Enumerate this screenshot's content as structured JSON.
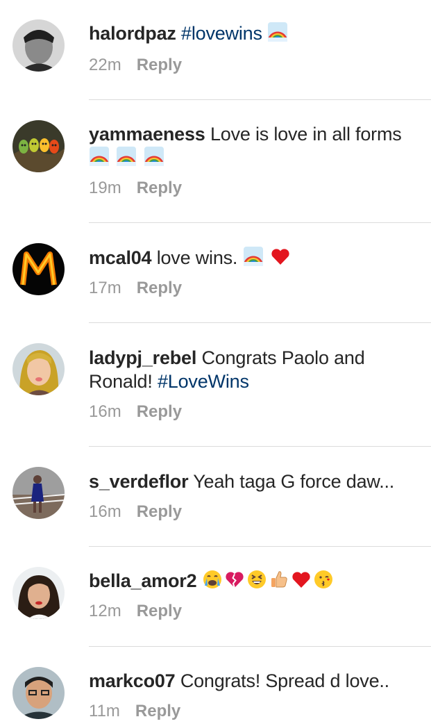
{
  "comments": [
    {
      "username": "halordpaz",
      "text": "",
      "hashtag": "#lovewins",
      "time": "22m",
      "reply_label": "Reply",
      "emojis": [
        "rainbow"
      ]
    },
    {
      "username": "yammaeness",
      "text": "Love is love in all forms",
      "time": "19m",
      "reply_label": "Reply",
      "emojis": [
        "rainbow",
        "rainbow",
        "rainbow"
      ]
    },
    {
      "username": "mcal04",
      "text": "love wins.",
      "time": "17m",
      "reply_label": "Reply",
      "emojis": [
        "rainbow",
        "red-heart"
      ]
    },
    {
      "username": "ladypj_rebel",
      "text": "Congrats Paolo and Ronald!",
      "hashtag": "#LoveWins",
      "time": "16m",
      "reply_label": "Reply"
    },
    {
      "username": "s_verdeflor",
      "text": "Yeah taga G force daw...",
      "time": "16m",
      "reply_label": "Reply"
    },
    {
      "username": "bella_amor2",
      "text": "",
      "time": "12m",
      "reply_label": "Reply",
      "emojis": [
        "crying-face",
        "broken-heart",
        "squinting-laugh",
        "thumbs-up",
        "red-heart",
        "kissing-face"
      ]
    },
    {
      "username": "markco07",
      "text": "Congrats! Spread d love..",
      "time": "11m",
      "reply_label": "Reply"
    }
  ],
  "colors": {
    "username": "#262626",
    "hashtag": "#003569",
    "meta": "#999999",
    "divider": "#dbdbdb"
  }
}
